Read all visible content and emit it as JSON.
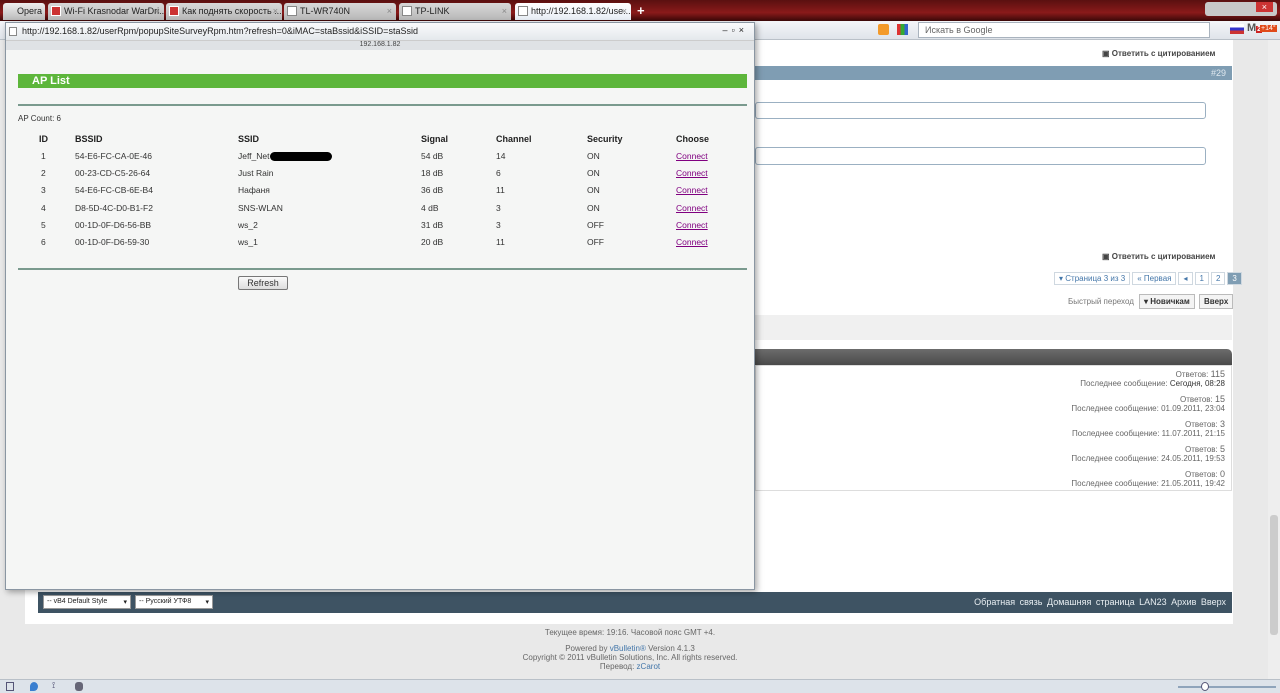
{
  "browser": {
    "menu_label": "Opera",
    "tabs": [
      {
        "label": "Wi-Fi Krasnodar WarDri..."
      },
      {
        "label": "Как поднять скорость ..."
      },
      {
        "label": "TL-WR740N"
      },
      {
        "label": "TP-LINK"
      },
      {
        "label": "http://192.168.1.82/use..."
      }
    ],
    "search_placeholder": "Искать в Google",
    "badge_mail": "2",
    "badge_weather": "+14°"
  },
  "forum": {
    "reply_quote": "Ответить с цитированием",
    "post_number": "#29",
    "pagination": {
      "label": "Страница 3 из 3",
      "first": "Первая",
      "pages": [
        "1",
        "2",
        "3"
      ]
    },
    "quick_nav_label": "Быстрый переход",
    "quick_nav_value": "Новичкам",
    "up_button": "Вверх",
    "threads": [
      {
        "replies_label": "Ответов:",
        "replies": "115",
        "last_label": "Последнее сообщение:",
        "last": "Сегодня, 08:28"
      },
      {
        "replies_label": "Ответов:",
        "replies": "15",
        "last_label": "Последнее сообщение:",
        "last": "01.09.2011, 23:04"
      },
      {
        "replies_label": "Ответов:",
        "replies": "3",
        "last_label": "Последнее сообщение:",
        "last": "11.07.2011, 21:15"
      },
      {
        "replies_label": "Ответов:",
        "replies": "5",
        "last_label": "Последнее сообщение:",
        "last": "24.05.2011, 19:53"
      },
      {
        "replies_label": "Ответов:",
        "replies": "0",
        "last_label": "Последнее сообщение:",
        "last": "21.05.2011, 19:42"
      }
    ],
    "footer": {
      "style_select": "-- vB4 Default Style",
      "lang_select": "-- Русский УТФ8",
      "links": [
        "Обратная связь",
        "Домашняя страница LAN23",
        "Архив",
        "Вверх"
      ],
      "time": "Текущее время: 19:16. Часовой пояс GMT +4.",
      "powered_prefix": "Powered by",
      "powered_link": "vBulletin®",
      "powered_suffix": "Version 4.1.3",
      "copyright": "Copyright © 2011 vBulletin Solutions, Inc. All rights reserved.",
      "translation_prefix": "Перевод:",
      "translation_link": "zCarot"
    }
  },
  "popup": {
    "url": "http://192.168.1.82/userRpm/popupSiteSurveyRpm.htm?refresh=0&iMAC=staBssid&iSSID=staSsid",
    "host": "192.168.1.82",
    "title": "AP List",
    "ap_count": "AP Count: 6",
    "columns": [
      "ID",
      "BSSID",
      "SSID",
      "Signal",
      "Channel",
      "Security",
      "Choose"
    ],
    "rows": [
      {
        "id": "1",
        "bssid": "54-E6-FC-CA-0E-46",
        "ssid": "Jeff_Net",
        "signal": "54 dB",
        "channel": "14",
        "security": "ON",
        "choose": "Connect"
      },
      {
        "id": "2",
        "bssid": "00-23-CD-C5-26-64",
        "ssid": "Just Rain",
        "signal": "18 dB",
        "channel": "6",
        "security": "ON",
        "choose": "Connect"
      },
      {
        "id": "3",
        "bssid": "54-E6-FC-CB-6E-B4",
        "ssid": "Нафаня",
        "signal": "36 dB",
        "channel": "11",
        "security": "ON",
        "choose": "Connect"
      },
      {
        "id": "4",
        "bssid": "D8-5D-4C-D0-B1-F2",
        "ssid": "SNS-WLAN",
        "signal": "4 dB",
        "channel": "3",
        "security": "ON",
        "choose": "Connect"
      },
      {
        "id": "5",
        "bssid": "00-1D-0F-D6-56-BB",
        "ssid": "ws_2",
        "signal": "31 dB",
        "channel": "3",
        "security": "OFF",
        "choose": "Connect"
      },
      {
        "id": "6",
        "bssid": "00-1D-0F-D6-59-30",
        "ssid": "ws_1",
        "signal": "20 dB",
        "channel": "11",
        "security": "OFF",
        "choose": "Connect"
      }
    ],
    "refresh": "Refresh"
  }
}
